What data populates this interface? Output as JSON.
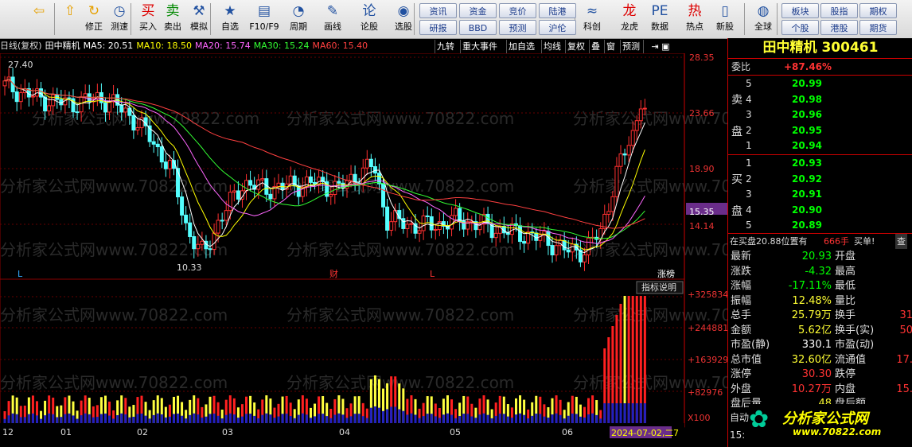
{
  "toolbar": {
    "buttons": [
      {
        "icon": "⇦",
        "label": ""
      },
      {
        "icon": "⇧",
        "label": ""
      },
      {
        "icon": "↻",
        "label": "修正"
      },
      {
        "icon": "◷",
        "label": "测速"
      },
      {
        "icon": "买",
        "label": "买入"
      },
      {
        "icon": "卖",
        "label": "卖出"
      },
      {
        "icon": "⚒",
        "label": "模拟"
      },
      {
        "icon": "★",
        "label": "自选"
      },
      {
        "icon": "▤",
        "label": "F10/F9"
      },
      {
        "icon": "◔",
        "label": "周期"
      },
      {
        "icon": "✎",
        "label": "画线"
      },
      {
        "icon": "论",
        "label": "论股"
      },
      {
        "icon": "◉",
        "label": "选股"
      },
      {
        "icon": "≈",
        "label": "科创"
      },
      {
        "icon": "龙",
        "label": "龙虎"
      },
      {
        "icon": "PE",
        "label": "数据"
      },
      {
        "icon": "热",
        "label": "热点"
      },
      {
        "icon": "▯",
        "label": "新股"
      },
      {
        "icon": "◍",
        "label": "全球"
      }
    ],
    "grid_buttons": [
      "资讯",
      "资金",
      "竞价",
      "陆港",
      "研报",
      "BBD",
      "预测",
      "沪伦"
    ],
    "right_buttons": [
      "板块",
      "股指",
      "期权",
      "个股",
      "港股",
      "期货"
    ]
  },
  "chart": {
    "mode": "日线(复权)",
    "stock_name": "田中精机",
    "ma5": "MA5: 20.51",
    "ma10": "MA10: 18.50",
    "ma20": "MA20: 15.74",
    "ma30": "MA30: 15.24",
    "ma60": "MA60: 15.40",
    "tabs": [
      "九转",
      "重大事件",
      "加自选",
      "均线",
      "复权",
      "叠",
      "窗",
      "预测"
    ],
    "price_axis": [
      "28.35",
      "23.66",
      "18.90",
      "15.35",
      "14.14"
    ],
    "high_label": "27.40",
    "low_label": "10.33",
    "markers": [
      "L",
      "财",
      "L",
      "涨榜"
    ],
    "vol_button": "指标说明",
    "vol_axis": [
      "+325834",
      "+244881",
      "+163929",
      "+82976",
      "X100"
    ],
    "x_axis": [
      "12",
      "01",
      "02",
      "03",
      "04",
      "05",
      "06"
    ],
    "date_highlight": "2024-07-02,二",
    "date_tail": "7",
    "watermark": "分析家公式网www.70822.com"
  },
  "quote": {
    "title": "田中精机 300461",
    "weibi_label": "委比",
    "weibi_value": "+87.46%",
    "sell_label": [
      "卖",
      "盘"
    ],
    "buy_label": [
      "买",
      "盘"
    ],
    "sell": [
      {
        "lvl": "5",
        "price": "20.99"
      },
      {
        "lvl": "4",
        "price": "20.98"
      },
      {
        "lvl": "3",
        "price": "20.96"
      },
      {
        "lvl": "2",
        "price": "20.95"
      },
      {
        "lvl": "1",
        "price": "20.94"
      }
    ],
    "buy": [
      {
        "lvl": "1",
        "price": "20.93"
      },
      {
        "lvl": "2",
        "price": "20.92"
      },
      {
        "lvl": "3",
        "price": "20.91"
      },
      {
        "lvl": "4",
        "price": "20.90"
      },
      {
        "lvl": "5",
        "price": "20.89"
      }
    ],
    "status_text": "在买盘20.88位置有",
    "status_qty": "666手",
    "status_buy": "买单!",
    "status_search": "查",
    "stats": [
      {
        "k1": "最新",
        "v1": "20.93",
        "c1": "#0f0",
        "k2": "开盘",
        "v2": ""
      },
      {
        "k1": "涨跌",
        "v1": "-4.32",
        "c1": "#0f0",
        "k2": "最高",
        "v2": ""
      },
      {
        "k1": "涨幅",
        "v1": "-17.11%",
        "c1": "#0f0",
        "k2": "最低",
        "v2": ""
      },
      {
        "k1": "振幅",
        "v1": "12.48%",
        "c1": "#ff3",
        "k2": "量比",
        "v2": ""
      },
      {
        "k1": "总手",
        "v1": "25.79万",
        "c1": "#ff3",
        "k2": "换手",
        "v2": "31"
      },
      {
        "k1": "金额",
        "v1": "5.62亿",
        "c1": "#ff3",
        "k2": "换手(实)",
        "v2": "50"
      },
      {
        "k1": "市盈(静)",
        "v1": "330.1",
        "c1": "#fff",
        "k2": "市盈(动)",
        "v2": ""
      },
      {
        "k1": "总市值",
        "v1": "32.60亿",
        "c1": "#ff3",
        "k2": "流通值",
        "v2": "17."
      },
      {
        "k1": "涨停",
        "v1": "30.30",
        "c1": "#f33",
        "k2": "跌停",
        "v2": ""
      },
      {
        "k1": "外盘",
        "v1": "10.27万",
        "c1": "#f33",
        "k2": "内盘",
        "v2": "15."
      },
      {
        "k1": "盘后量",
        "v1": "48",
        "c1": "#ff3",
        "k2": "盘后额",
        "v2": ""
      }
    ],
    "footer_left": "自动",
    "footer_time": "15:",
    "logo_text": "分析家公式网",
    "logo_url": "www.70822.com"
  },
  "colors": {
    "up": "#ff3030",
    "down": "#54ffff",
    "ma5": "#ffffff",
    "ma10": "#ffff00",
    "ma20": "#ff66ff",
    "ma30": "#33ff33",
    "ma60": "#ff4040"
  }
}
